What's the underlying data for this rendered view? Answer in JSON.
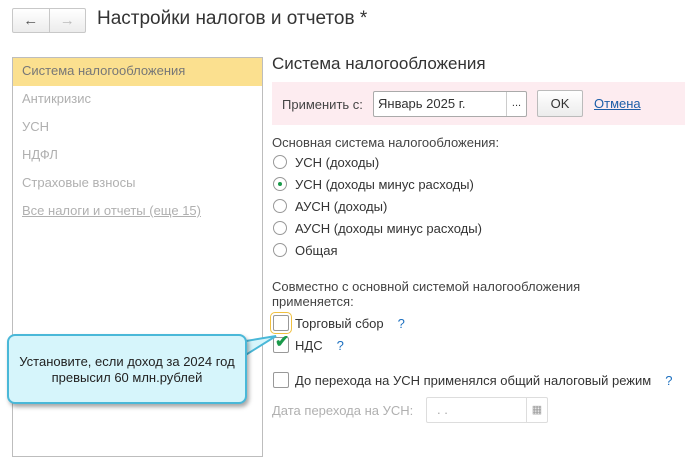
{
  "header": {
    "title": "Настройки налогов и отчетов *",
    "back": "←",
    "forward": "→"
  },
  "sidebar": {
    "items": [
      {
        "label": "Система налогообложения"
      },
      {
        "label": "Антикризис"
      },
      {
        "label": "УСН"
      },
      {
        "label": "НДФЛ"
      },
      {
        "label": "Страховые взносы"
      },
      {
        "label": "Все налоги и отчеты (еще 15)"
      }
    ]
  },
  "main": {
    "section_title": "Система налогообложения",
    "apply": {
      "label": "Применить с:",
      "value": "Январь 2025 г.",
      "picker": "...",
      "ok": "OK",
      "cancel": "Отмена"
    },
    "main_system_label": "Основная система налогообложения:",
    "options": [
      "УСН (доходы)",
      "УСН (доходы минус расходы)",
      "АУСН (доходы)",
      "АУСН (доходы минус расходы)",
      "Общая"
    ],
    "selected": "УСН (доходы минус расходы)",
    "together_label": "Совместно с основной системой налогообложения применяется:",
    "trade_fee": {
      "label": "Торговый сбор",
      "checked": false,
      "help": "?"
    },
    "vat": {
      "label": "НДС",
      "checked": true,
      "help": "?"
    },
    "prior_general": {
      "label": "До перехода на УСН применялся общий налоговый режим",
      "checked": false,
      "help": "?"
    },
    "transition_date": {
      "label": "Дата перехода на УСН:",
      "value": " .  ."
    }
  },
  "tooltip": {
    "text1": "Установите, если доход за 2024 год",
    "text2": "превысил 60 млн.рублей"
  }
}
